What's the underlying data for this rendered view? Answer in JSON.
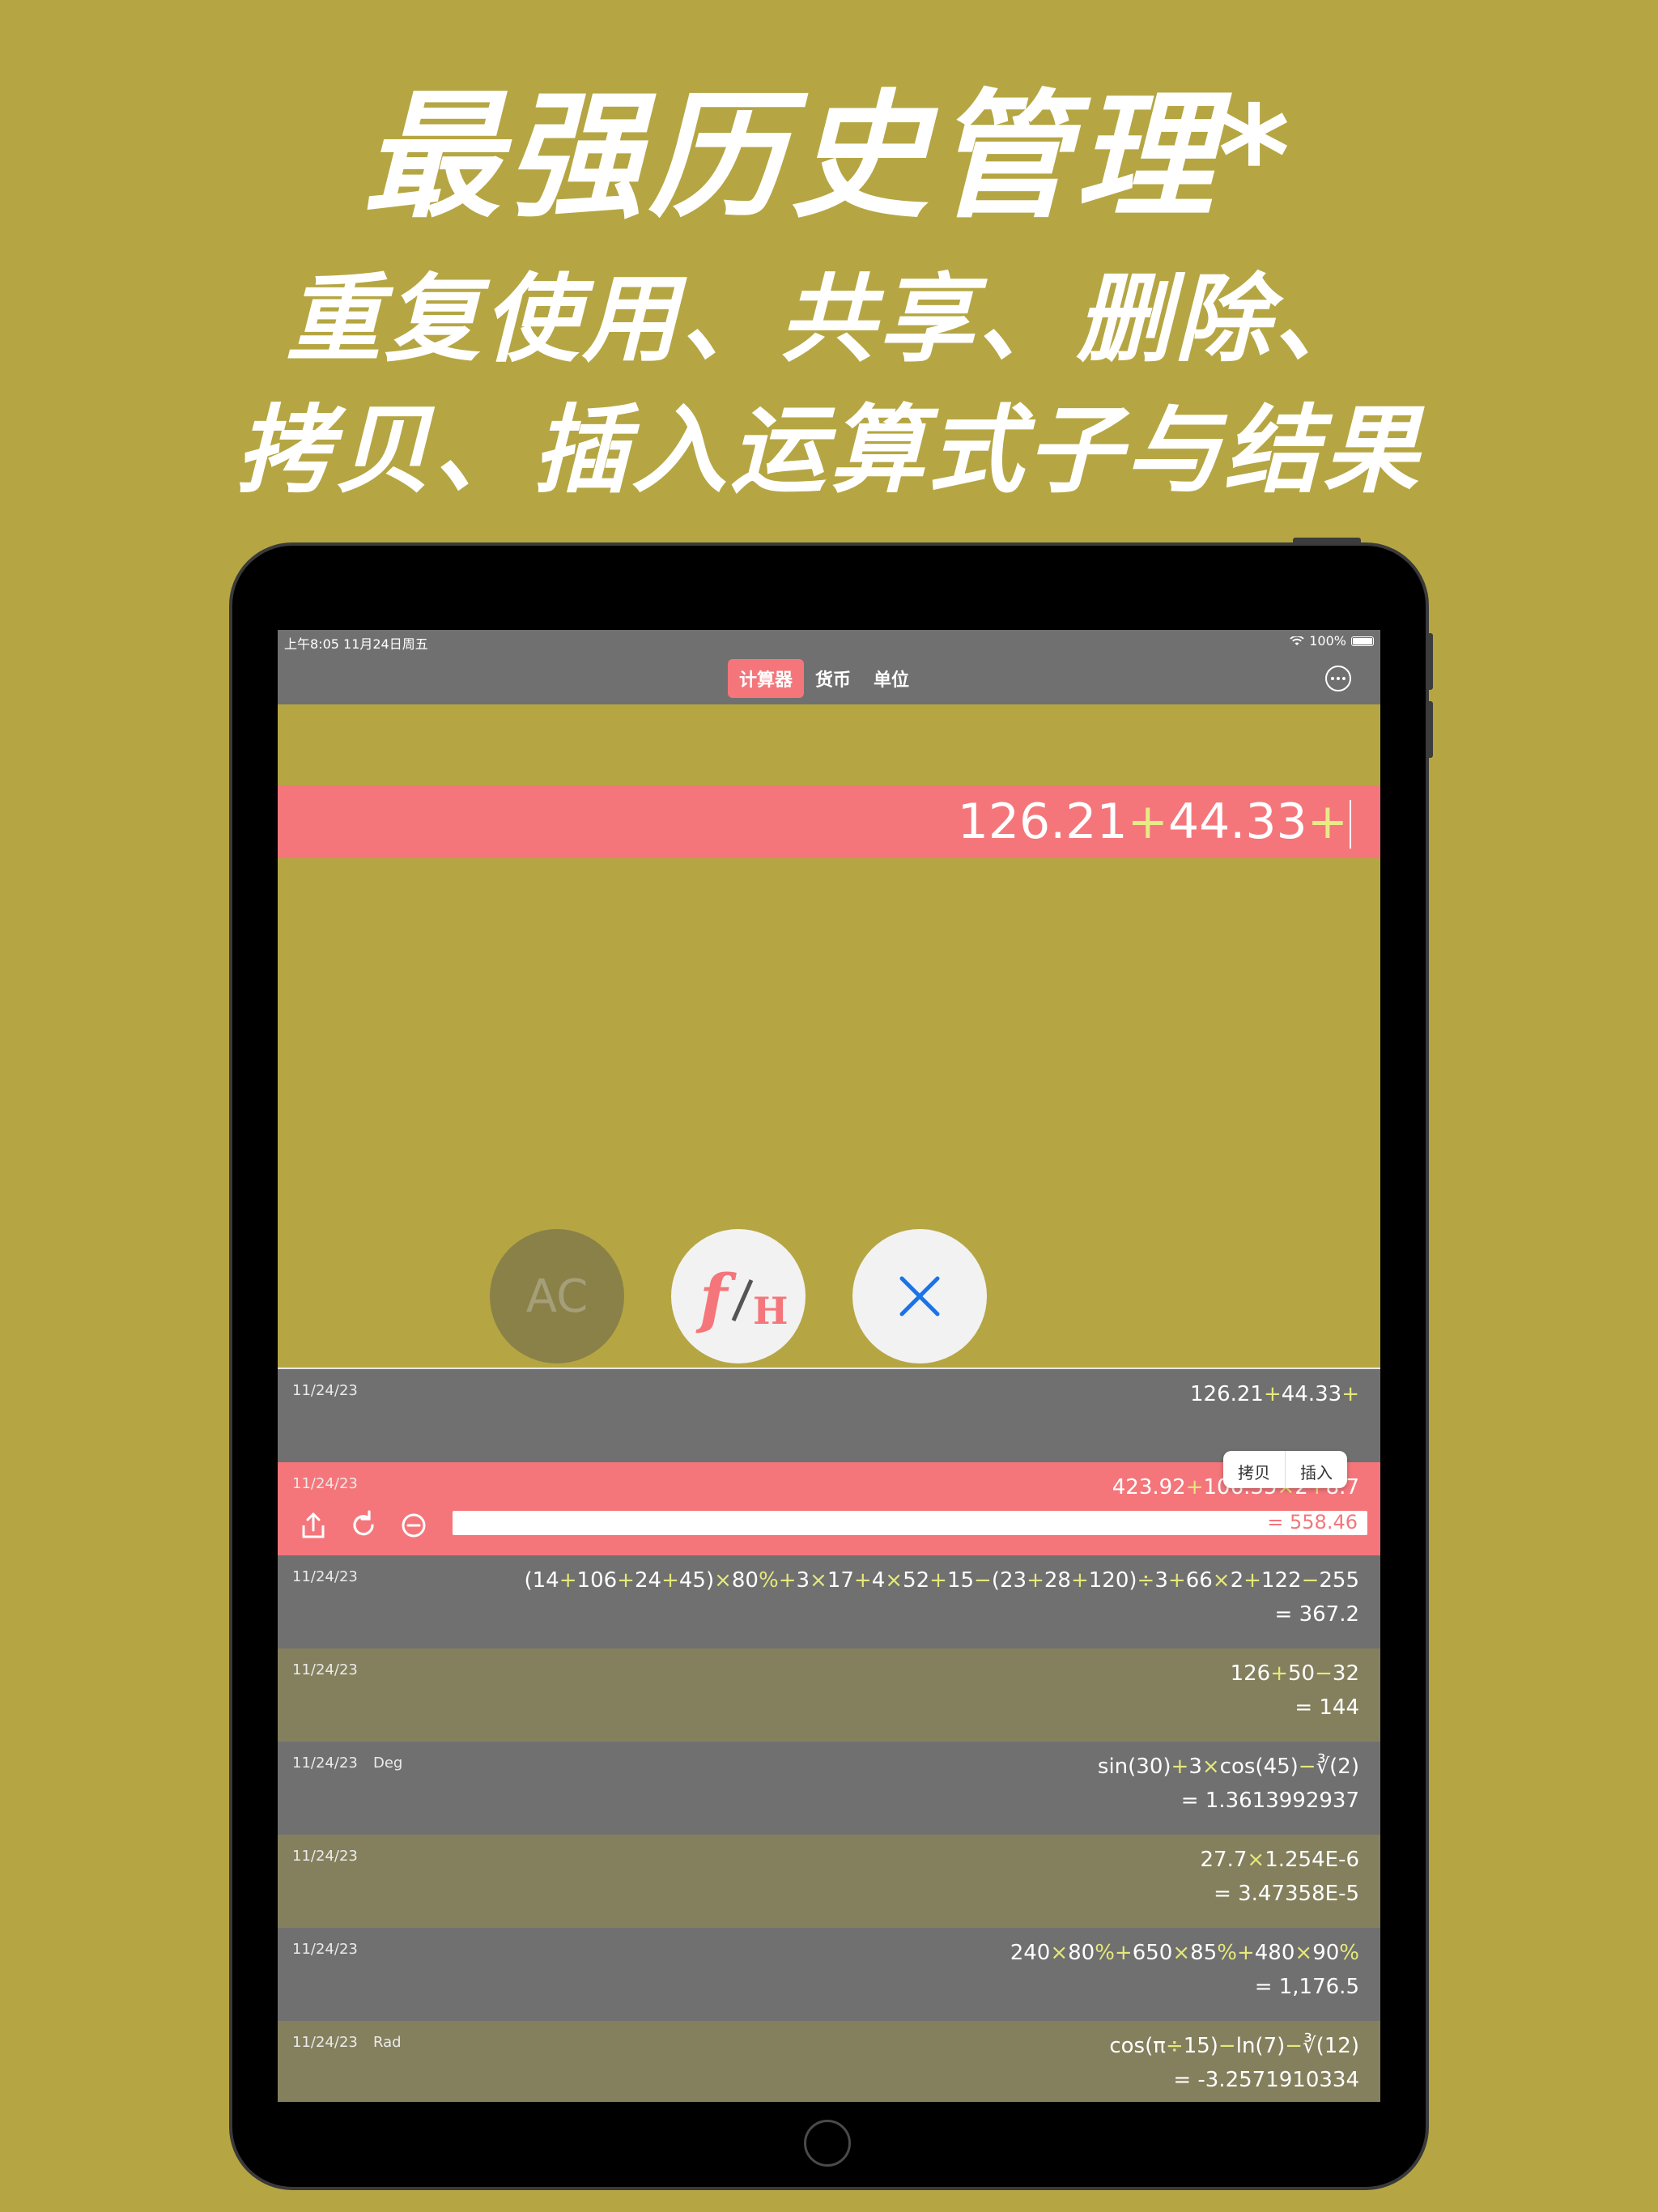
{
  "promo": {
    "title": "最强历史管理*",
    "line2": "重复使用、共享、删除、",
    "line3": "拷贝、插入运算式子与结果"
  },
  "status": {
    "time_date": "上午8:05   11月24日周五",
    "battery": "100%"
  },
  "nav": {
    "tabs": [
      "计算器",
      "货币",
      "单位"
    ],
    "active_tab": "计算器",
    "more_icon": "ellipsis-circle-icon"
  },
  "display": {
    "n1": "126.21",
    "op1": "+",
    "n2": "44.33",
    "op2": "+"
  },
  "buttons": {
    "ac": "AC",
    "fh_icon": "function-history-icon",
    "close_icon": "close-icon"
  },
  "popup": {
    "copy": "拷贝",
    "insert": "插入"
  },
  "history": [
    {
      "date": "11/24/23",
      "mode": "",
      "result": ""
    },
    {
      "date": "11/24/23",
      "mode": "",
      "result": "= 558.46"
    },
    {
      "date": "11/24/23",
      "mode": "",
      "result": "= 367.2"
    },
    {
      "date": "11/24/23",
      "mode": "",
      "result": "= 144"
    },
    {
      "date": "11/24/23",
      "mode": "Deg",
      "result": "= 1.3613992937"
    },
    {
      "date": "11/24/23",
      "mode": "",
      "result": "= 3.47358E-5"
    },
    {
      "date": "11/24/23",
      "mode": "",
      "result": "= 1,176.5"
    },
    {
      "date": "11/24/23",
      "mode": "Rad",
      "result": "= -3.2571910334"
    }
  ],
  "colors": {
    "background": "#b5a643",
    "accent_pink": "#f4767b",
    "row_gray": "#707070",
    "row_olive": "#84805e",
    "operator_yellow": "#e6e97a",
    "x_button_blue": "#1a73e8"
  }
}
